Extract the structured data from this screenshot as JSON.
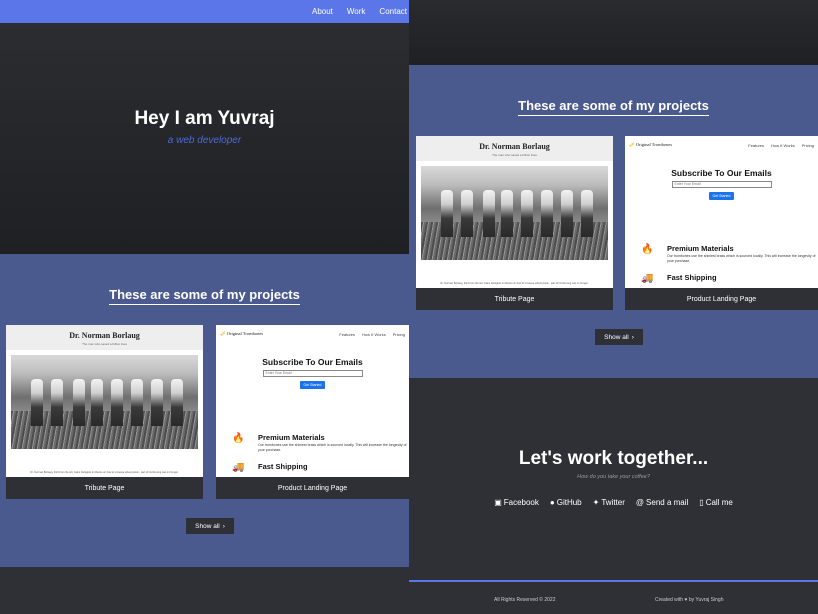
{
  "nav": {
    "items": [
      "About",
      "Work",
      "Contact"
    ]
  },
  "hero": {
    "name": "Hey I am Yuvraj",
    "role": "a web developer"
  },
  "projects": {
    "title": "These are some of my projects",
    "tiles": [
      {
        "label": "Tribute Page",
        "preview": {
          "title": "Dr. Norman Borlaug",
          "subtitle": "The man who saved a billion lives",
          "caption": "Dr. Norman Borlaug, third from the left, trains biologists in Mexico on how to increase wheat yields - part of his life-long war on hunger."
        }
      },
      {
        "label": "Product Landing Page",
        "preview": {
          "logo": "Original Trombones",
          "links": [
            "Features",
            "How It Works",
            "Pricing"
          ],
          "heading": "Subscribe To Our Emails",
          "input_placeholder": "Enter Your Email",
          "button": "Get Started",
          "features": [
            {
              "title": "Premium Materials",
              "desc": "Our trombones use the shiniest brass which is sourced locally. This will increase the longevity of your purchase."
            },
            {
              "title": "Fast Shipping",
              "desc": ""
            }
          ]
        }
      }
    ],
    "show_all": "Show all"
  },
  "contact": {
    "title": "Let's work together...",
    "subtitle": "How do you take your coffee?",
    "links": [
      {
        "icon": "facebook-icon",
        "label": "Facebook"
      },
      {
        "icon": "github-icon",
        "label": "GitHub"
      },
      {
        "icon": "twitter-icon",
        "label": "Twitter"
      },
      {
        "icon": "email-icon",
        "label": "Send a mail"
      },
      {
        "icon": "phone-icon",
        "label": "Call me"
      }
    ]
  },
  "footer": {
    "left": "All Rights Reserved © 2022",
    "right": "Created with ♥ by Yuvraj Singh"
  },
  "colors": {
    "nav": "#5b76e8",
    "projects_bg": "#4b5a8e",
    "dark": "#2e3036",
    "accent_text": "#4b6ad6"
  }
}
